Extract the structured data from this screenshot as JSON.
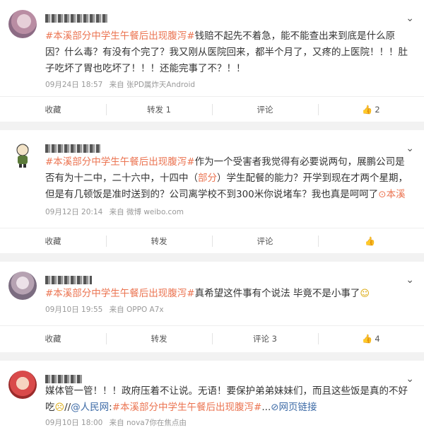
{
  "posts": [
    {
      "username": "",
      "text_parts": [
        {
          "t": "#本溪部分中学生午餐后出现腹泻#",
          "c": "tag"
        },
        {
          "t": "钱赔不起先不着急，能不能查出来到底是什么原因？什么毒？有没有个完了？我又刚从医院回来，都半个月了，又疼的上医院！！！肚子吃坏了胃也吃坏了！！！还能完事了不？！！",
          "c": ""
        }
      ],
      "date": "09月24日 18:57",
      "source": "来自 张PD属炸天Android",
      "actions": {
        "favorite": "收藏",
        "repost": "转发 1",
        "comment": "评论",
        "like": "2"
      }
    },
    {
      "username": "",
      "text_parts": [
        {
          "t": "#本溪部分中学生午餐后出现腹泻#",
          "c": "tag"
        },
        {
          "t": "作为一个受害者我觉得有必要说两句，展鹏公司是否有为十二中，二十六中，十四中（",
          "c": ""
        },
        {
          "t": "部分",
          "c": "tag"
        },
        {
          "t": "）学生配餐的能力？开学到现在才两个星期，但是有几顿饭是准时送到的？公司离学校不到300米你说堵车？我也真是呵呵了",
          "c": ""
        },
        {
          "t": "⊙本溪",
          "c": "tag"
        }
      ],
      "date": "09月12日 20:14",
      "source": "来自 微博 weibo.com",
      "actions": {
        "favorite": "收藏",
        "repost": "转发",
        "comment": "评论",
        "like": ""
      }
    },
    {
      "username": "",
      "text_parts": [
        {
          "t": "#本溪部分中学生午餐后出现腹泻#",
          "c": "tag"
        },
        {
          "t": "真希望这件事有个说法 毕竟不是小事了",
          "c": ""
        },
        {
          "t": "☺",
          "c": "emoji"
        }
      ],
      "date": "09月10日 19:55",
      "source": "来自 OPPO A7x",
      "actions": {
        "favorite": "收藏",
        "repost": "转发",
        "comment": "评论 3",
        "like": "4"
      }
    },
    {
      "username": "",
      "text_parts": [
        {
          "t": "媒体管一管！！！政府压着不让说。无语！要保护弟弟妹妹们，而且这些饭是真的不好吃",
          "c": ""
        },
        {
          "t": "☹",
          "c": "emoji"
        },
        {
          "t": "//",
          "c": ""
        },
        {
          "t": "@人民网",
          "c": "link"
        },
        {
          "t": ":",
          "c": ""
        },
        {
          "t": "#本溪部分中学生午餐后出现腹泻#",
          "c": "tag"
        },
        {
          "t": "...",
          "c": ""
        },
        {
          "t": "⊘网页链接",
          "c": "link"
        }
      ],
      "date": "09月10日 18:00",
      "source": "来自 nova7你在焦点由",
      "actions": {}
    }
  ],
  "colors": {
    "topic": "#eb7350",
    "link": "#3c6aa6",
    "meta": "#999999"
  }
}
